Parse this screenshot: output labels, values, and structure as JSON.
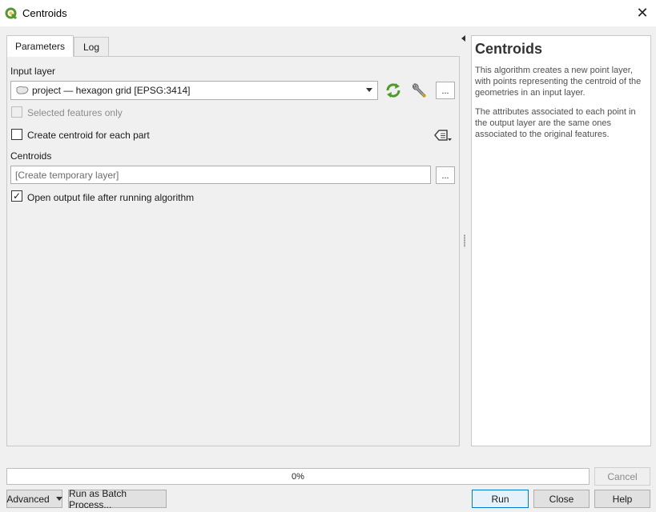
{
  "window": {
    "title": "Centroids"
  },
  "tabs": {
    "parameters": "Parameters",
    "log": "Log"
  },
  "params": {
    "input_layer_label": "Input layer",
    "input_layer_value": "project — hexagon grid [EPSG:3414]",
    "selected_only_label": "Selected features only",
    "each_part_label": "Create centroid for each part",
    "centroids_label": "Centroids",
    "centroids_placeholder": "[Create temporary layer]",
    "open_output_label": "Open output file after running algorithm",
    "open_output_checked": "✓",
    "more_button": "..."
  },
  "help": {
    "title": "Centroids",
    "paragraph1": "This algorithm creates a new point layer, with points representing the centroid of the geometries in an input layer.",
    "paragraph2": "The attributes associated to each point in the output layer are the same ones associated to the original features."
  },
  "progress": {
    "text": "0%",
    "value": 0
  },
  "buttons": {
    "cancel": "Cancel",
    "advanced": "Advanced",
    "batch": "Run as Batch Process...",
    "run": "Run",
    "close": "Close",
    "help": "Help"
  },
  "colors": {
    "qgis_green": "#589632",
    "accent_blue": "#0078d7"
  }
}
